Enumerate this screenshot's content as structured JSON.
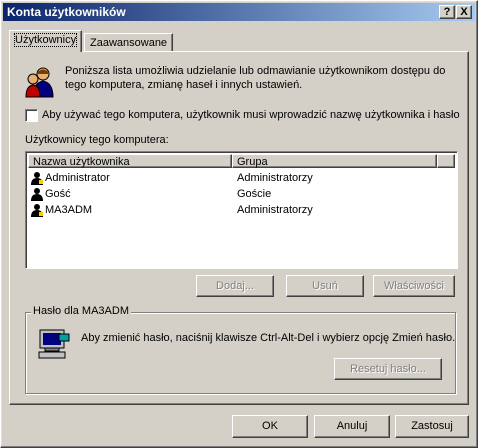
{
  "window": {
    "title": "Konta użytkowników",
    "help_btn": "?",
    "close_btn": "X"
  },
  "tabs": [
    {
      "label": "Użytkownicy"
    },
    {
      "label": "Zaawansowane"
    }
  ],
  "intro_text_1": "Poniższa lista umożliwia udzielanie lub odmawianie użytkownikom dostępu do",
  "intro_text_2": "tego komputera, zmianę haseł i innych ustawień.",
  "require_login_checkbox_label": "Aby używać tego komputera, użytkownik musi wprowadzić nazwę użytkownika i hasło",
  "users_section_label": "Użytkownicy tego komputera:",
  "table": {
    "columns": [
      "Nazwa użytkownika",
      "Grupa"
    ],
    "rows": [
      {
        "name": "Administrator",
        "group": "Administratorzy"
      },
      {
        "name": "Gość",
        "group": "Goście"
      },
      {
        "name": "MA3ADM",
        "group": "Administratorzy"
      }
    ]
  },
  "buttons": {
    "add": "Dodaj...",
    "remove": "Usuń",
    "properties": "Właściwości",
    "reset_password": "Resetuj hasło...",
    "ok": "OK",
    "cancel": "Anuluj",
    "apply": "Zastosuj"
  },
  "password_group": {
    "label": "Hasło dla MA3ADM",
    "text": "Aby zmienić hasło, naciśnij klawisze Ctrl-Alt-Del i wybierz opcję Zmień hasło."
  },
  "icons": {
    "users_icon": "users-icon",
    "user_icon": "user-icon",
    "computer_icon": "computer-icon"
  }
}
